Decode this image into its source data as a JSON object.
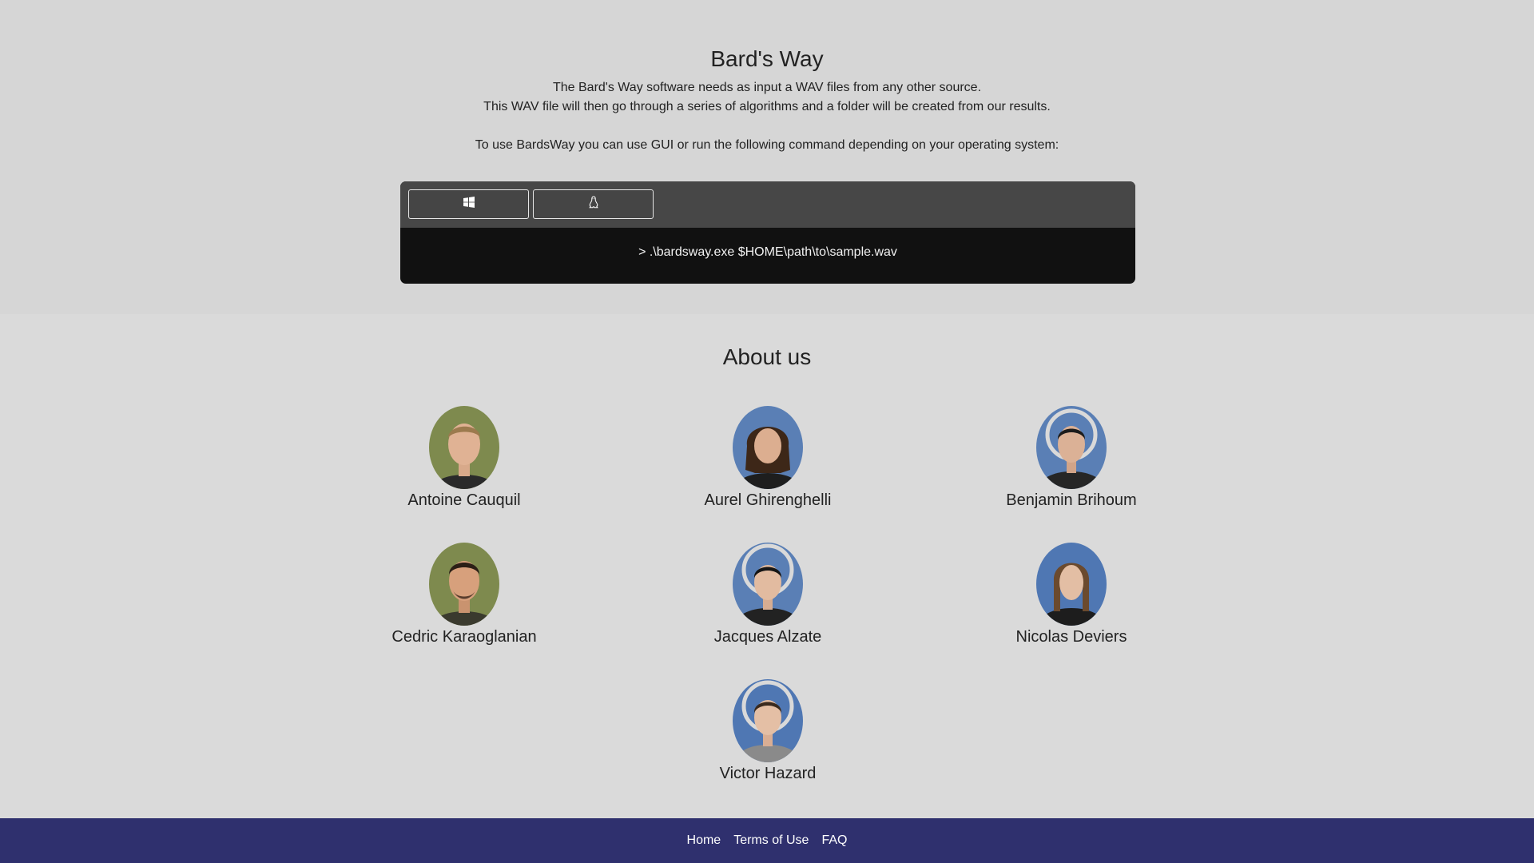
{
  "hero": {
    "title": "Bard's Way",
    "desc_line1": "The Bard's Way software needs as input a WAV files from any other source.",
    "desc_line2": "This WAV file will then go through a series of algorithms and a folder will be created from our results.",
    "usage_line": "To use BardsWay you can use GUI or run the following command depending on your operating system:"
  },
  "terminal": {
    "tabs": [
      {
        "icon": "windows-icon"
      },
      {
        "icon": "linux-tux-icon"
      }
    ],
    "command": "> .\\bardsway.exe $HOME\\path\\to\\sample.wav"
  },
  "about": {
    "title": "About us",
    "members": [
      {
        "name": "Antoine Cauquil",
        "bg": "#7e8a4e"
      },
      {
        "name": "Aurel Ghirenghelli",
        "bg": "#5a7fb5"
      },
      {
        "name": "Benjamin Brihoum",
        "bg": "#5a7fb5"
      },
      {
        "name": "Cedric Karaoglanian",
        "bg": "#7e8a4e"
      },
      {
        "name": "Jacques Alzate",
        "bg": "#5a7fb5"
      },
      {
        "name": "Nicolas Deviers",
        "bg": "#4f77b3"
      },
      {
        "name": "Victor Hazard",
        "bg": "#4f77b3"
      }
    ]
  },
  "footer": {
    "links": [
      "Home",
      "Terms of Use",
      "FAQ"
    ]
  },
  "colors": {
    "page_bg": "#d6d6d6",
    "terminal_bar": "#474747",
    "terminal_body": "#111111",
    "footer_bg": "#2f306e"
  }
}
